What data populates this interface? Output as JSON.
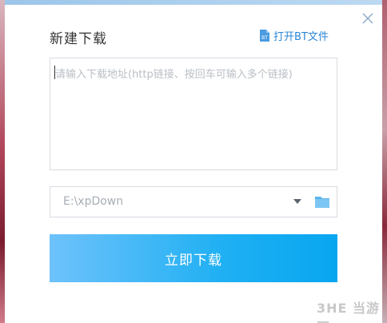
{
  "dialog": {
    "title": "新建下载",
    "open_bt_label": "打开BT文件",
    "url_placeholder": "请输入下载地址(http链接、按回车可输入多个链接)",
    "save_path": "E:\\xpDown",
    "download_button_label": "立即下载"
  },
  "watermark": "3HE 当游网",
  "colors": {
    "accent": "#1fb0f3",
    "link": "#2a86d6",
    "folder": "#58b4ec"
  }
}
